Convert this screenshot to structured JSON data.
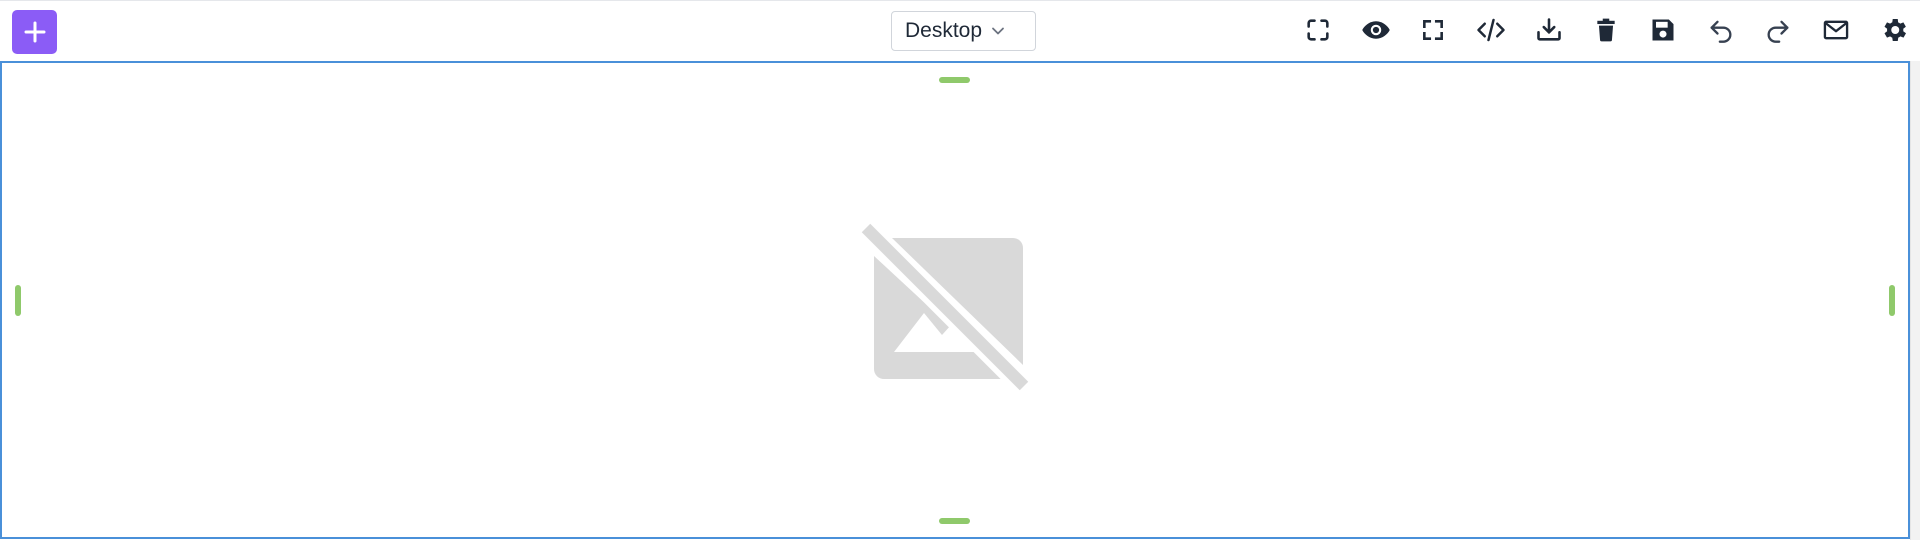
{
  "toolbar": {
    "add_label": "+",
    "device_select": {
      "value": "Desktop"
    },
    "actions": [
      {
        "name": "select-mode-icon"
      },
      {
        "name": "preview-icon"
      },
      {
        "name": "fullscreen-icon"
      },
      {
        "name": "code-icon"
      },
      {
        "name": "download-icon"
      },
      {
        "name": "trash-icon"
      },
      {
        "name": "save-icon"
      },
      {
        "name": "undo-icon"
      },
      {
        "name": "redo-icon"
      },
      {
        "name": "mail-icon"
      },
      {
        "name": "gear-icon"
      }
    ]
  },
  "canvas": {
    "placeholder_icon": "image-not-supported-icon"
  },
  "colors": {
    "accent": "#8b5cf6",
    "selection_border": "#4a90d9",
    "resize_handle": "#8fc96b",
    "placeholder_icon": "#d9d9d9",
    "icon": "#1f2937"
  }
}
